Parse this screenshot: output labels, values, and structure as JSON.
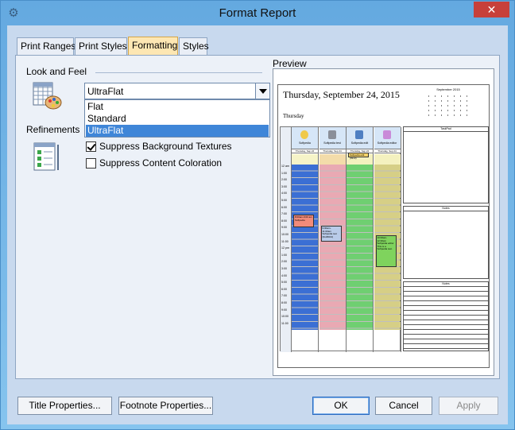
{
  "window": {
    "title": "Format Report",
    "close_symbol": "✕",
    "sys_icon": "gear-icon"
  },
  "tabs": [
    {
      "label": "Print Ranges",
      "active": false
    },
    {
      "label": "Print Styles",
      "active": false
    },
    {
      "label": "Formatting",
      "active": true
    },
    {
      "label": "Styles",
      "active": false
    }
  ],
  "look_and_feel": {
    "label": "Look and Feel",
    "selected": "UltraFlat",
    "options": [
      "Flat",
      "Standard",
      "UltraFlat"
    ],
    "icon": "palette-calendar-icon"
  },
  "refinements": {
    "label": "Refinements",
    "icon": "checklist-icon",
    "options": [
      {
        "label": "Suppress Background Textures",
        "checked": true
      },
      {
        "label": "Suppress Content Coloration",
        "checked": false
      }
    ]
  },
  "preview": {
    "label": "Preview",
    "date_title": "Thursday, September 24, 2015",
    "day_label": "Thursday",
    "mini_calendar_title": "September 2015",
    "time_labels": [
      "12 am",
      "1:00",
      "2:00",
      "3:00",
      "4:00",
      "5:00",
      "6:00",
      "7:00",
      "8:00",
      "9:00",
      "10:00",
      "11:00",
      "12 pm",
      "1:00",
      "2:00",
      "3:00",
      "4:00",
      "5:00",
      "6:00",
      "7:00",
      "8:00",
      "9:00",
      "10:00",
      "11:00"
    ],
    "resources": [
      {
        "name": "Softpedia",
        "date": "Thursday, Sep 24",
        "color": "#3b6fd4",
        "band": "#f6f4c8",
        "icon": "smiley-icon"
      },
      {
        "name": "Softpedia test",
        "date": "Thursday, Sep 24",
        "color": "#e9a9b3",
        "band": "#f3dcaa",
        "icon": "robot-icon"
      },
      {
        "name": "Softpedia edit",
        "date": "Thursday, Sep 24",
        "color": "#6fcf71",
        "band": "#f4f1bf",
        "icon": "pencil-icon"
      },
      {
        "name": "Softpedia editor",
        "date": "Thursday, Sep 24",
        "color": "#d6cf86",
        "band": "#f4f1bf",
        "icon": "bottle-icon"
      }
    ],
    "events": [
      {
        "resource": 0,
        "text": "8:00am-9:00 am Softpedia",
        "bg": "#f18b7a"
      },
      {
        "resource": 1,
        "text": "9:00am-11:00am Softpedia test (9129913)",
        "bg": "#b9cbe9"
      },
      {
        "resource": 2,
        "text": "Softpedia edit (9913)",
        "bg": "#f4d36a"
      },
      {
        "resource": 3,
        "text": "10:00am-12:30pm Softpedia editor This is a Softpedia test.",
        "bg": "#7fd35d"
      }
    ],
    "notes": [
      {
        "title": "TaskPad"
      },
      {
        "title": "Notes"
      },
      {
        "title": "Notes"
      }
    ]
  },
  "buttons": {
    "title_properties": "Title Properties...",
    "footnote_properties": "Footnote Properties...",
    "ok": "OK",
    "cancel": "Cancel",
    "apply": "Apply"
  },
  "colors": {
    "active_tab": "#fde7b3",
    "selection": "#3f86d8",
    "frame": "#64a9e0"
  }
}
